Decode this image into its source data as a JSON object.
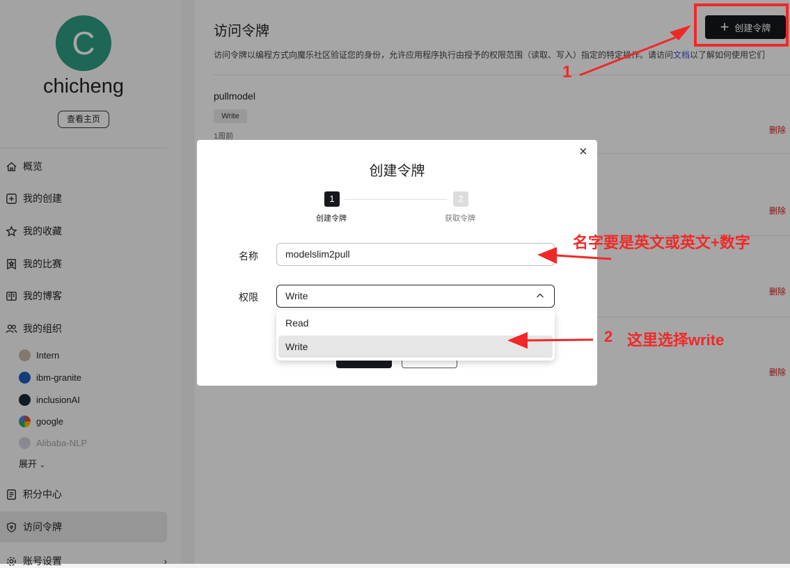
{
  "sidebar": {
    "avatar_letter": "C",
    "username": "chicheng",
    "home_label": "查看主页",
    "nav": [
      "概览",
      "我的创建",
      "我的收藏",
      "我的比赛",
      "我的博客",
      "我的组织"
    ],
    "orgs": [
      "Intern",
      "ibm-granite",
      "inclusionAI",
      "google",
      "Alibaba-NLP"
    ],
    "expand_label": "展开",
    "nav2": [
      "积分中心",
      "访问令牌",
      "账号设置"
    ]
  },
  "main": {
    "title": "访问令牌",
    "desc_before": "访问令牌以编程方式向魔乐社区验证您的身份，允许应用程序执行由授予的权限范围（读取、写入）指定的特定操作。请访问",
    "desc_link": "文档",
    "desc_after": "以了解如何使用它们",
    "create_label": "创建令牌",
    "token": {
      "name": "pullmodel",
      "permission": "Write",
      "time": "1周前"
    },
    "delete_label": "删除"
  },
  "modal": {
    "title": "创建令牌",
    "close": "×",
    "steps": [
      {
        "num": "1",
        "label": "创建令牌"
      },
      {
        "num": "2",
        "label": "获取令牌"
      }
    ],
    "name_label": "名称",
    "name_value": "modelslim2pull",
    "perm_label": "权限",
    "perm_value": "Write",
    "options": [
      "Read",
      "Write"
    ]
  },
  "annotations": {
    "n1": "1",
    "name_hint": "名字要是英文或英文+数字",
    "n2": "2",
    "perm_hint": "这里选择write"
  },
  "colors": {
    "accent": "#16181d",
    "annotation": "#f02828",
    "delete": "#d02020",
    "link": "#3a5ccc"
  }
}
